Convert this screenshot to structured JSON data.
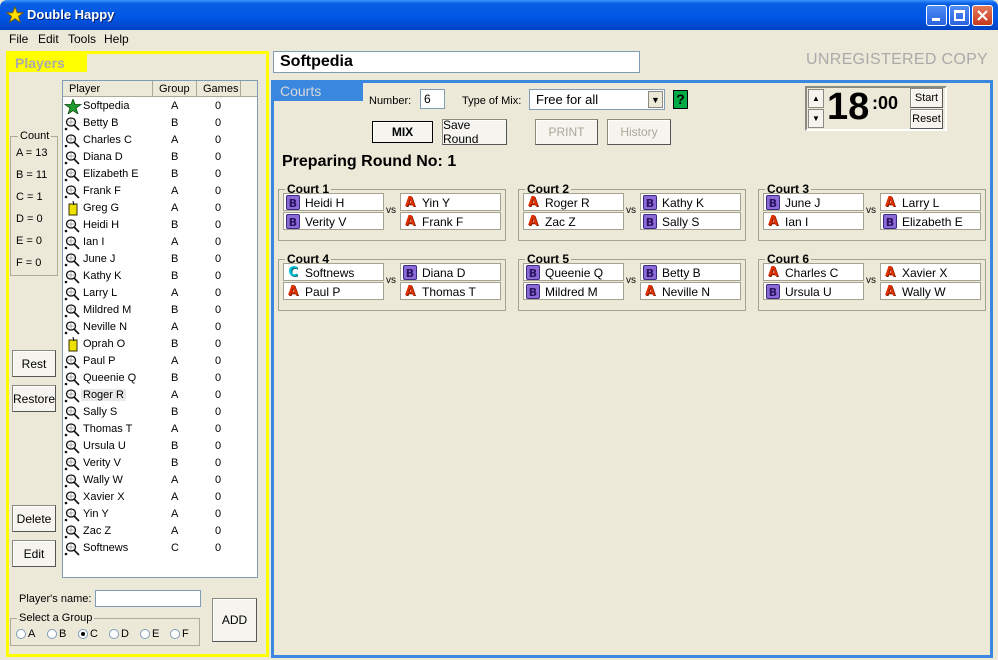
{
  "window": {
    "title": "Double Happy"
  },
  "menu": [
    "File",
    "Edit",
    "Tools",
    "Help"
  ],
  "players_panel": {
    "tab": "Players",
    "count": {
      "title": "Count",
      "lines": [
        "A = 13",
        "B = 11",
        "C = 1",
        "D = 0",
        "E = 0",
        "F = 0"
      ]
    },
    "buttons": {
      "rest": "Rest",
      "restore": "Restore",
      "delete": "Delete",
      "edit": "Edit",
      "add": "ADD"
    },
    "columns": [
      "Player",
      "Group",
      "Games"
    ],
    "players": [
      {
        "name": "Softpedia",
        "group": "A",
        "games": "0",
        "icon": "star-icon"
      },
      {
        "name": "Betty B",
        "group": "B",
        "games": "0",
        "icon": "racket-icon"
      },
      {
        "name": "Charles C",
        "group": "A",
        "games": "0",
        "icon": "racket-icon"
      },
      {
        "name": "Diana D",
        "group": "B",
        "games": "0",
        "icon": "racket-icon"
      },
      {
        "name": "Elizabeth E",
        "group": "B",
        "games": "0",
        "icon": "racket-icon"
      },
      {
        "name": "Frank F",
        "group": "A",
        "games": "0",
        "icon": "racket-icon"
      },
      {
        "name": "Greg G",
        "group": "A",
        "games": "0",
        "icon": "drink-icon"
      },
      {
        "name": "Heidi H",
        "group": "B",
        "games": "0",
        "icon": "racket-icon"
      },
      {
        "name": "Ian I",
        "group": "A",
        "games": "0",
        "icon": "racket-icon"
      },
      {
        "name": "June J",
        "group": "B",
        "games": "0",
        "icon": "racket-icon"
      },
      {
        "name": "Kathy K",
        "group": "B",
        "games": "0",
        "icon": "racket-icon"
      },
      {
        "name": "Larry L",
        "group": "A",
        "games": "0",
        "icon": "racket-icon"
      },
      {
        "name": "Mildred M",
        "group": "B",
        "games": "0",
        "icon": "racket-icon"
      },
      {
        "name": "Neville N",
        "group": "A",
        "games": "0",
        "icon": "racket-icon"
      },
      {
        "name": "Oprah O",
        "group": "B",
        "games": "0",
        "icon": "drink-icon"
      },
      {
        "name": "Paul P",
        "group": "A",
        "games": "0",
        "icon": "racket-icon"
      },
      {
        "name": "Queenie Q",
        "group": "B",
        "games": "0",
        "icon": "racket-icon"
      },
      {
        "name": "Roger R",
        "group": "A",
        "games": "0",
        "icon": "racket-icon",
        "selected": true
      },
      {
        "name": "Sally S",
        "group": "B",
        "games": "0",
        "icon": "racket-icon"
      },
      {
        "name": "Thomas T",
        "group": "A",
        "games": "0",
        "icon": "racket-icon"
      },
      {
        "name": "Ursula U",
        "group": "B",
        "games": "0",
        "icon": "racket-icon"
      },
      {
        "name": "Verity V",
        "group": "B",
        "games": "0",
        "icon": "racket-icon"
      },
      {
        "name": "Wally W",
        "group": "A",
        "games": "0",
        "icon": "racket-icon"
      },
      {
        "name": "Xavier X",
        "group": "A",
        "games": "0",
        "icon": "racket-icon"
      },
      {
        "name": "Yin Y",
        "group": "A",
        "games": "0",
        "icon": "racket-icon"
      },
      {
        "name": "Zac Z",
        "group": "A",
        "games": "0",
        "icon": "racket-icon"
      },
      {
        "name": "Softnews",
        "group": "C",
        "games": "0",
        "icon": "racket-icon"
      }
    ],
    "player_name_label": "Player's name:",
    "player_name_value": "",
    "select_group_label": "Select a Group",
    "groups": [
      "A",
      "B",
      "C",
      "D",
      "E",
      "F"
    ],
    "selected_group": "C"
  },
  "header": {
    "title_value": "Softpedia",
    "unregistered": "UNREGISTERED COPY"
  },
  "courts_panel": {
    "tab": "Courts",
    "number_label": "Number:",
    "number_value": "6",
    "mix_label": "Type of Mix:",
    "mix_value": "Free for all",
    "help_label": "?",
    "buttons": {
      "mix": "MIX",
      "save_round": "Save Round",
      "print": "PRINT",
      "history": "History"
    },
    "timer": {
      "minutes": "18",
      "seconds": ":00",
      "start": "Start",
      "reset": "Reset"
    },
    "round_title": "Preparing Round No: 1",
    "vs": "vs",
    "courts": [
      {
        "name": "Court 1",
        "left": [
          {
            "n": "Heidi H",
            "g": "B"
          },
          {
            "n": "Verity V",
            "g": "B"
          }
        ],
        "right": [
          {
            "n": "Yin Y",
            "g": "A"
          },
          {
            "n": "Frank F",
            "g": "A"
          }
        ]
      },
      {
        "name": "Court 2",
        "left": [
          {
            "n": "Roger R",
            "g": "A"
          },
          {
            "n": "Zac Z",
            "g": "A"
          }
        ],
        "right": [
          {
            "n": "Kathy K",
            "g": "B"
          },
          {
            "n": "Sally S",
            "g": "B"
          }
        ]
      },
      {
        "name": "Court 3",
        "left": [
          {
            "n": "June J",
            "g": "B"
          },
          {
            "n": "Ian I",
            "g": "A"
          }
        ],
        "right": [
          {
            "n": "Larry L",
            "g": "A"
          },
          {
            "n": "Elizabeth E",
            "g": "B"
          }
        ]
      },
      {
        "name": "Court 4",
        "left": [
          {
            "n": "Softnews",
            "g": "C"
          },
          {
            "n": "Paul P",
            "g": "A"
          }
        ],
        "right": [
          {
            "n": "Diana D",
            "g": "B"
          },
          {
            "n": "Thomas T",
            "g": "A"
          }
        ]
      },
      {
        "name": "Court 5",
        "left": [
          {
            "n": "Queenie Q",
            "g": "B"
          },
          {
            "n": "Mildred M",
            "g": "B"
          }
        ],
        "right": [
          {
            "n": "Betty B",
            "g": "B"
          },
          {
            "n": "Neville N",
            "g": "A"
          }
        ]
      },
      {
        "name": "Court 6",
        "left": [
          {
            "n": "Charles C",
            "g": "A"
          },
          {
            "n": "Ursula U",
            "g": "B"
          }
        ],
        "right": [
          {
            "n": "Xavier X",
            "g": "A"
          },
          {
            "n": "Wally W",
            "g": "A"
          }
        ]
      }
    ]
  },
  "colors": {
    "players_accent": "#ffff00",
    "courts_accent": "#3a87e0",
    "titlebar": "#0055e5"
  }
}
